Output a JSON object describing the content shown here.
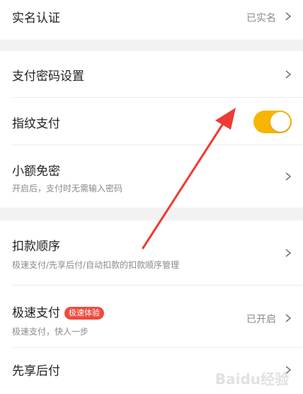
{
  "rows": {
    "real_name": {
      "title": "实名认证",
      "value": "已实名"
    },
    "pay_password": {
      "title": "支付密码设置"
    },
    "fingerprint": {
      "title": "指纹支付",
      "enabled": true
    },
    "small_free": {
      "title": "小额免密",
      "subtitle": "开启后，支付时无需输入密码"
    },
    "deduct_order": {
      "title": "扣款顺序",
      "subtitle": "极速支付/先享后付/自动扣款的扣款顺序管理"
    },
    "fast_pay": {
      "title": "极速支付",
      "badge": "极速体验",
      "subtitle": "极速支付，快人一步",
      "value": "已开启"
    },
    "pay_later": {
      "title": "先享后付"
    }
  },
  "colors": {
    "accent": "#f7b500",
    "badge": "#f04a3e",
    "arrow": "#ee3b34"
  },
  "watermark": "Baidu经验"
}
